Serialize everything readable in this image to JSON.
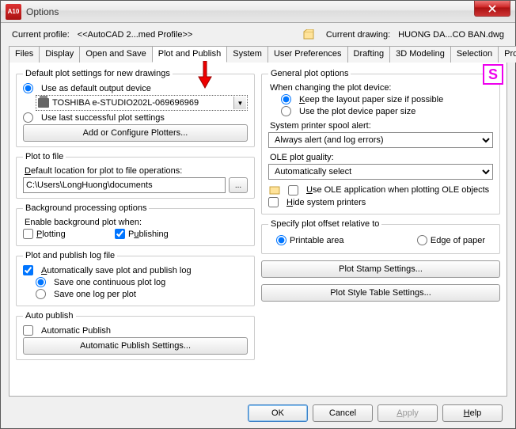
{
  "window": {
    "app_icon_text": "A10",
    "title": "Options"
  },
  "header": {
    "current_profile_label": "Current profile:",
    "current_profile_value": "<<AutoCAD 2...med Profile>>",
    "current_drawing_label": "Current drawing:",
    "current_drawing_value": "HUONG DA...CO BAN.dwg"
  },
  "tabs": {
    "files": "Files",
    "display": "Display",
    "open_and_save": "Open and Save",
    "plot_and_publish": "Plot and Publish",
    "system": "System",
    "user_preferences": "User Preferences",
    "drafting": "Drafting",
    "modeling": "3D Modeling",
    "selection": "Selection",
    "profiles": "Profiles"
  },
  "left": {
    "default_plot": {
      "legend": "Default plot settings for new drawings",
      "use_default_device": "Use as default output device",
      "device_value": "TOSHIBA e-STUDIO202L-069696969",
      "use_last_successful": "Use last successful plot settings",
      "add_configure_btn": "Add or Configure Plotters..."
    },
    "plot_to_file": {
      "legend": "Plot to file",
      "default_loc_label": "Default location for plot to file operations:",
      "path_value": "C:\\Users\\LongHuong\\documents"
    },
    "bg_processing": {
      "legend": "Background processing options",
      "enable_label": "Enable background plot when:",
      "plotting": "Plotting",
      "publishing": "Publishing"
    },
    "log": {
      "legend": "Plot and publish log file",
      "auto_save": "Automatically save plot and publish log",
      "one_continuous": "Save one continuous plot log",
      "one_per_plot": "Save one log per plot"
    },
    "auto_publish": {
      "legend": "Auto publish",
      "automatic_publish": "Automatic Publish",
      "settings_btn": "Automatic Publish Settings..."
    }
  },
  "right": {
    "general": {
      "legend": "General plot options",
      "when_changing": "When changing the plot device:",
      "keep_layout": "Keep the layout paper size if possible",
      "use_device_paper": "Use the plot device paper size",
      "spool_label": "System printer spool alert:",
      "spool_value": "Always alert (and log errors)",
      "ole_quality_label": "OLE plot quality:",
      "ole_quality_value": "Automatically select",
      "use_ole_app": "Use OLE application when plotting OLE objects",
      "hide_printers": "Hide system printers"
    },
    "offset": {
      "legend": "Specify plot offset relative to",
      "printable": "Printable area",
      "edge": "Edge of paper"
    },
    "stamp_btn": "Plot Stamp Settings...",
    "style_btn": "Plot Style Table Settings..."
  },
  "footer": {
    "ok": "OK",
    "cancel": "Cancel",
    "apply": "Apply",
    "help": "Help"
  },
  "annotations": {
    "s_badge": "S"
  }
}
